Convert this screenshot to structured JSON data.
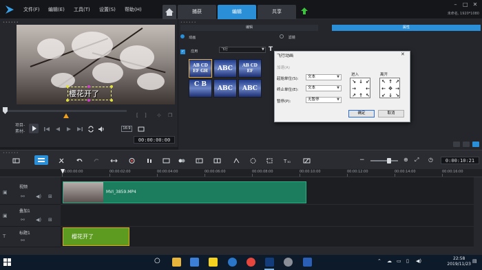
{
  "menu": {
    "file": "文件(F)",
    "edit": "编辑(E)",
    "tools": "工具(T)",
    "settings": "设置(S)",
    "help": "帮助(H)"
  },
  "workspace_tabs": [
    {
      "label": "捕获",
      "active": false
    },
    {
      "label": "编辑",
      "active": true
    },
    {
      "label": "共享",
      "active": false
    }
  ],
  "project_info": {
    "line1": "未命名, 1920*1080"
  },
  "preview": {
    "title_text": "樱花开了",
    "mode_project": "项目-",
    "mode_clip": "素材-",
    "timecode": "00:00:00:00",
    "size_label": "16:9"
  },
  "options": {
    "tab_attr": "编辑",
    "tab_effect": "属性",
    "radio_anim": "动画",
    "radio_filter": "滤镜",
    "apply_label": "应用",
    "anim_type": "飞行",
    "presets": [
      {
        "text": "AB CD EF GH"
      },
      {
        "text": "ABC"
      },
      {
        "text": "AB CD EF"
      },
      {
        "text": "C B"
      },
      {
        "text": "ABC"
      },
      {
        "text": "ABC"
      }
    ]
  },
  "dialog": {
    "title": "飞行动画",
    "pause_check": "加速(A)",
    "start_unit_label": "起始单位(S):",
    "start_unit_value": "文本",
    "end_unit_label": "终止单位(E):",
    "end_unit_value": "文本",
    "pause_label": "暂停(P):",
    "pause_value": "无暂停",
    "enter_label": "进入",
    "exit_label": "离开",
    "ok": "确定",
    "cancel": "取消"
  },
  "timeline": {
    "timecode": "0:00:10:21",
    "ruler": [
      "00:00:00:00",
      "00:00:02:00",
      "00:00:04:00",
      "00:00:06:00",
      "00:00:08:00",
      "00:00:10:00",
      "00:00:12:00",
      "00:00:14:00",
      "00:00:16:00"
    ],
    "tracks": [
      {
        "name": "视频"
      },
      {
        "name": "叠加1"
      },
      {
        "name": "标题1"
      }
    ],
    "video_clip_label": "MVI_3859.MP4",
    "title_clip_label": "樱花开了"
  },
  "taskbar": {
    "time": "22:58",
    "date": "2019/11/23"
  },
  "colors": {
    "accent": "#2a8fd6",
    "video_clip": "#1b7d5e",
    "title_clip": "#5d9b20"
  }
}
